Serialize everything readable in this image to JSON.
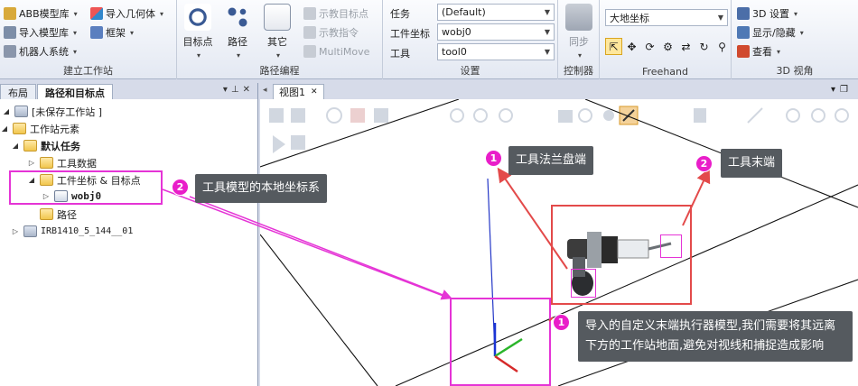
{
  "ribbon": {
    "build_station": {
      "group_label": "建立工作站",
      "abb_library": "ABB模型库",
      "import_library": "导入模型库",
      "robot_system": "机器人系统",
      "import_geometry": "导入几何体",
      "frame": "框架"
    },
    "path_programming": {
      "group_label": "路径编程",
      "target": "目标点",
      "path": "路径",
      "other": "其它",
      "teach_target": "示教目标点",
      "teach_instruction": "示教指令",
      "multimove": "MultiMove"
    },
    "settings": {
      "group_label": "设置",
      "task_label": "任务",
      "task_value": "(Default)",
      "wobj_label": "工件坐标",
      "wobj_value": "wobj0",
      "tool_label": "工具",
      "tool_value": "tool0"
    },
    "controller": {
      "group_label": "控制器",
      "sync": "同步"
    },
    "freehand": {
      "group_label": "Freehand",
      "frame_value": "大地坐标"
    },
    "view3d": {
      "group_label": "3D 视角",
      "settings_3d": "3D 设置",
      "show_hide": "显示/隐藏",
      "view": "查看"
    }
  },
  "left_panel": {
    "tabs": [
      "布局",
      "路径和目标点"
    ],
    "tree": {
      "root": "[未保存工作站 ]",
      "station_elements": "工作站元素",
      "default_task": "默认任务",
      "tool_data": "工具数据",
      "wobj_targets": "工件坐标 & 目标点",
      "wobj0": "wobj0",
      "paths": "路径",
      "robot": "IRB1410_5_144__01"
    }
  },
  "viewport": {
    "tab_label": "视图1"
  },
  "annotations": {
    "tool_flange": {
      "number": "1",
      "text": "工具法兰盘端"
    },
    "tool_end": {
      "number": "2",
      "text": "工具末端"
    },
    "local_frame": {
      "number": "2",
      "text": "工具模型的本地坐标系"
    },
    "imported_model": {
      "number": "1",
      "text": "导入的自定义末端执行器模型,我们需要将其远离下方的工作站地面,避免对视线和捕捉造成影响"
    }
  },
  "colors": {
    "magenta": "#e534d6",
    "red": "#e34a4a",
    "callout_bg": "#555a5f"
  }
}
